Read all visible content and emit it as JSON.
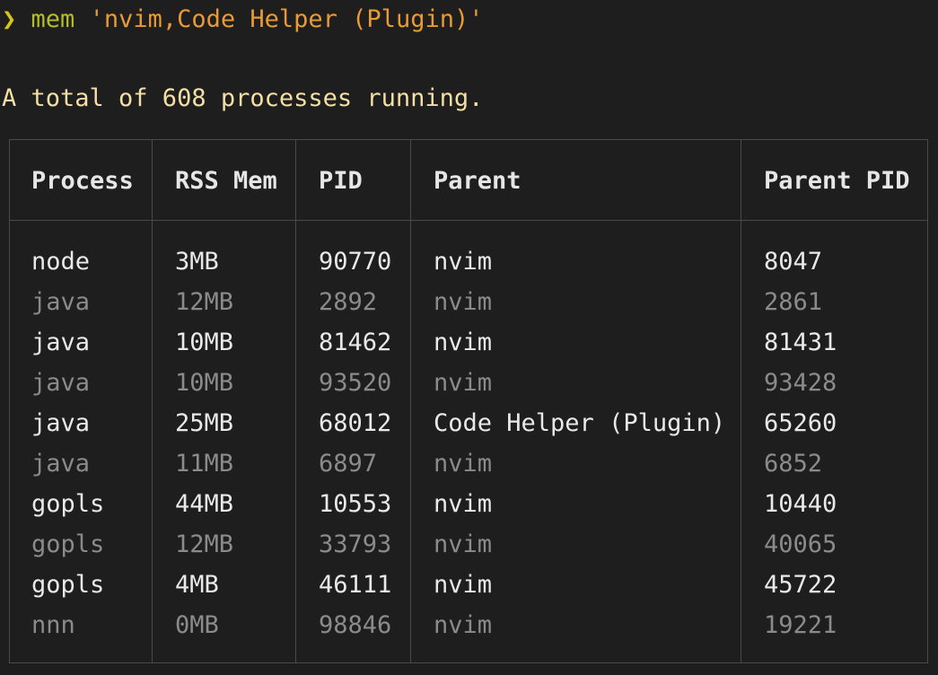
{
  "prompt": {
    "chevron": "❯",
    "command": "mem",
    "argument": "'nvim,Code Helper (Plugin)'"
  },
  "summary": "A total of 608 processes running.",
  "table": {
    "headers": [
      "Process",
      "RSS Mem",
      "PID",
      "Parent",
      "Parent PID"
    ],
    "rows": [
      {
        "process": "node",
        "rss": "3MB",
        "pid": "90770",
        "parent": "nvim",
        "parent_pid": "8047"
      },
      {
        "process": "java",
        "rss": "12MB",
        "pid": "2892",
        "parent": "nvim",
        "parent_pid": "2861"
      },
      {
        "process": "java",
        "rss": "10MB",
        "pid": "81462",
        "parent": "nvim",
        "parent_pid": "81431"
      },
      {
        "process": "java",
        "rss": "10MB",
        "pid": "93520",
        "parent": "nvim",
        "parent_pid": "93428"
      },
      {
        "process": "java",
        "rss": "25MB",
        "pid": "68012",
        "parent": "Code Helper (Plugin)",
        "parent_pid": "65260"
      },
      {
        "process": "java",
        "rss": "11MB",
        "pid": "6897",
        "parent": "nvim",
        "parent_pid": "6852"
      },
      {
        "process": "gopls",
        "rss": "44MB",
        "pid": "10553",
        "parent": "nvim",
        "parent_pid": "10440"
      },
      {
        "process": "gopls",
        "rss": "12MB",
        "pid": "33793",
        "parent": "nvim",
        "parent_pid": "40065"
      },
      {
        "process": "gopls",
        "rss": "4MB",
        "pid": "46111",
        "parent": "nvim",
        "parent_pid": "45722"
      },
      {
        "process": "nnn",
        "rss": "0MB",
        "pid": "98846",
        "parent": "nvim",
        "parent_pid": "19221"
      }
    ]
  },
  "colors": {
    "background": "#1e1e1e",
    "prompt_chevron": "#d7c419",
    "command": "#b5bd2a",
    "argument": "#e89a35",
    "summary": "#f4dfa4",
    "row_bright": "#e9e9e9",
    "row_dim": "#8b8b8b",
    "border": "#4a4a4a"
  }
}
